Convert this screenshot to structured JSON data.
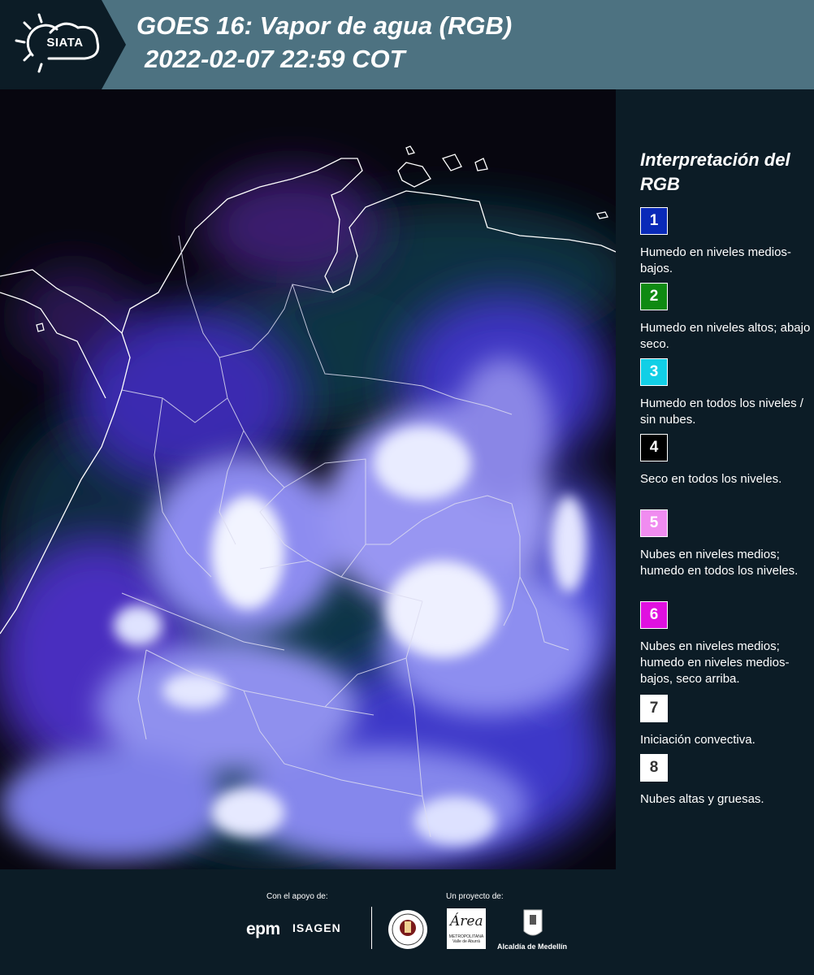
{
  "header": {
    "logo_text": "SIATA",
    "title_line1": "GOES 16: Vapor de agua (RGB)",
    "title_line2": "2022-02-07 22:59 COT"
  },
  "legend": {
    "title": "Interpretación del RGB",
    "items": [
      {
        "number": "1",
        "color": "#0a2ab8",
        "text_color": "#ffffff",
        "description": "Humedo en niveles medios-bajos."
      },
      {
        "number": "2",
        "color": "#0f8a12",
        "text_color": "#ffffff",
        "description": "Humedo en niveles altos; abajo seco."
      },
      {
        "number": "3",
        "color": "#12cfe6",
        "text_color": "#ffffff",
        "description": "Humedo en todos los niveles / sin nubes."
      },
      {
        "number": "4",
        "color": "#000000",
        "text_color": "#ffffff",
        "description": "Seco en todos los niveles."
      },
      {
        "number": "5",
        "color": "#f08cf0",
        "text_color": "#ffffff",
        "description": "Nubes en niveles medios; humedo en todos los niveles."
      },
      {
        "number": "6",
        "color": "#e010e0",
        "text_color": "#ffffff",
        "description": "Nubes en niveles medios; humedo en niveles medios-bajos, seco arriba."
      },
      {
        "number": "7",
        "color": "#ffffff",
        "text_color": "#333333",
        "description": "Iniciación convectiva."
      },
      {
        "number": "8",
        "color": "#ffffff",
        "text_color": "#333333",
        "description": "Nubes altas y gruesas."
      }
    ]
  },
  "footer": {
    "support_label": "Con el apoyo de:",
    "project_label": "Un proyecto de:",
    "logos": {
      "epm": "epm",
      "isagen": "ISAGEN",
      "area_word": "Área",
      "area_sub": "METROPOLITANA Valle de Aburrá",
      "medellin": "Alcaldía de Medellín"
    }
  }
}
